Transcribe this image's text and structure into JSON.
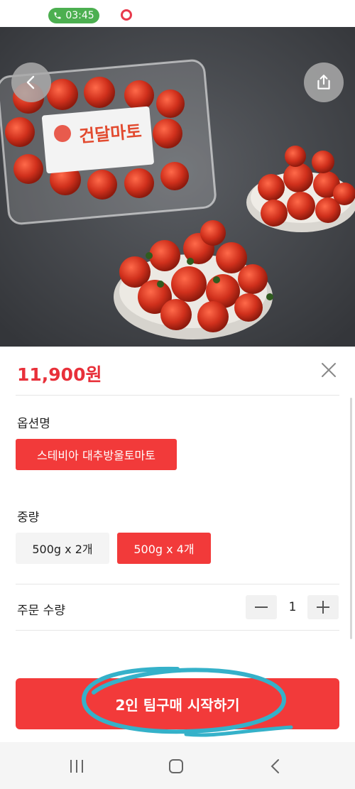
{
  "status_bar": {
    "call_time": "03:45",
    "call_icon": "phone-icon",
    "app_icon": "notification-app-icon"
  },
  "hero": {
    "image_label": "건달마토",
    "back_icon": "chevron-left-icon",
    "share_icon": "share-icon"
  },
  "product": {
    "price": "11,900원",
    "close_icon": "close-icon"
  },
  "options": {
    "option_name_label": "옵션명",
    "option_name_value": "스테비아 대추방울토마토",
    "weight_label": "중량",
    "weight_choices": [
      {
        "label": "500g x 2개",
        "selected": false
      },
      {
        "label": "500g x 4개",
        "selected": true
      }
    ]
  },
  "quantity": {
    "label": "주문 수량",
    "value": "1",
    "minus_icon": "minus-icon",
    "plus_icon": "plus-icon"
  },
  "cta": {
    "label": "2인 팀구매 시작하기"
  },
  "colors": {
    "accent": "#f23a3a",
    "price": "#e8303a",
    "annotation": "#35b1c9"
  }
}
